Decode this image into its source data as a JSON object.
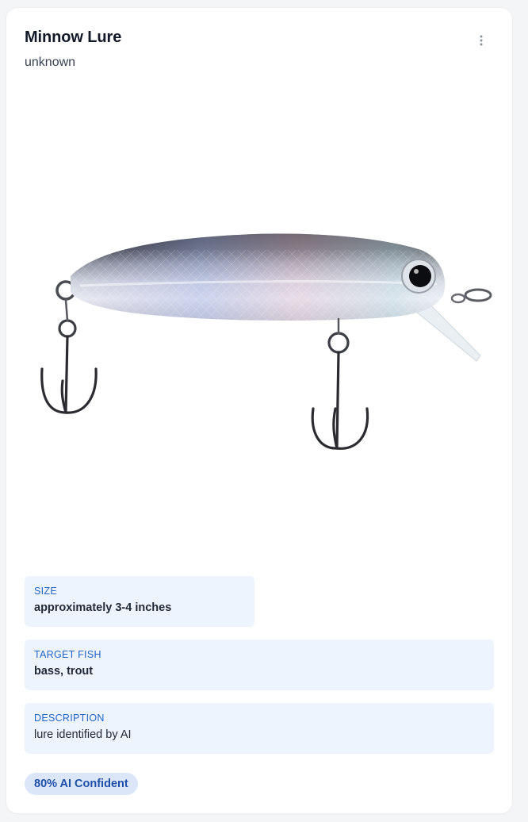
{
  "card": {
    "title": "Minnow Lure",
    "subtitle": "unknown",
    "menu_icon": "more-vertical-icon",
    "image": "minnow-lure-image"
  },
  "details": {
    "size": {
      "label": "SIZE",
      "value": "approximately 3-4 inches"
    },
    "target_fish": {
      "label": "TARGET FISH",
      "value": "bass, trout"
    },
    "description": {
      "label": "DESCRIPTION",
      "value": "lure identified by AI"
    }
  },
  "confidence": {
    "label": "80% AI Confident",
    "percent": 80
  },
  "colors": {
    "info_bg": "#eef4fd",
    "label_blue": "#2563c9",
    "badge_bg": "#dbe7f9",
    "badge_text": "#1e4fa8"
  }
}
